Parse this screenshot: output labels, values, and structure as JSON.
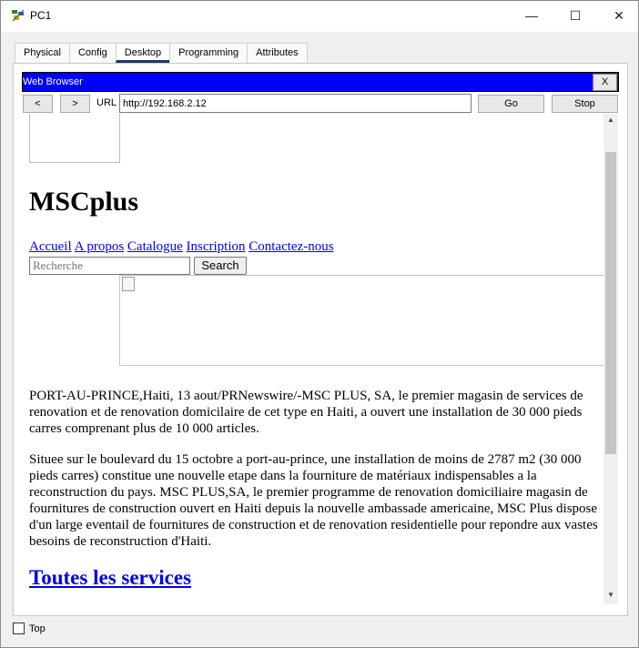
{
  "window": {
    "title": "PC1",
    "minimize_glyph": "—",
    "maximize_glyph": "☐",
    "close_glyph": "✕"
  },
  "tabs": [
    {
      "label": "Physical",
      "active": false
    },
    {
      "label": "Config",
      "active": false
    },
    {
      "label": "Desktop",
      "active": true
    },
    {
      "label": "Programming",
      "active": false
    },
    {
      "label": "Attributes",
      "active": false
    }
  ],
  "browser": {
    "title": "Web Browser",
    "close_label": "X",
    "back_label": "<",
    "forward_label": ">",
    "url_label": "URL",
    "url_value": "http://192.168.2.12",
    "go_label": "Go",
    "stop_label": "Stop",
    "title_color": "#0000ff"
  },
  "page": {
    "site_title": "MSCplus",
    "nav_links": [
      "Accueil",
      "A propos",
      "Catalogue",
      "Inscription",
      "Contactez-nous"
    ],
    "search_placeholder": "Recherche",
    "search_button": "Search",
    "paragraph1": "PORT-AU-PRINCE,Haiti, 13 aout/PRNewswire/-MSC PLUS, SA, le premier magasin de services de renovation et de renovation domicilaire de cet type en Haiti, a ouvert une installation de 30 000 pieds carres comprenant plus de 10 000 articles.",
    "paragraph2": "Situee sur le boulevard du 15 octobre a port-au-prince, une installation de moins de 2787 m2 (30 000 pieds carres) constitue une nouvelle etape dans la fourniture de matériaux indispensables a la reconstruction du pays. MSC PLUS,SA, le premier programme de renovation domiciliaire magasin de fournitures de construction ouvert en Haiti depuis la nouvelle ambassade americaine, MSC Plus dispose d'un large eventail de fournitures de construction et de renovation residentielle pour repondre aux vastes besoins de reconstruction d'Haiti.",
    "services_heading": "Toutes les services",
    "link_color": "#0000ee"
  },
  "footer": {
    "top_label": "Top",
    "top_checked": false
  }
}
